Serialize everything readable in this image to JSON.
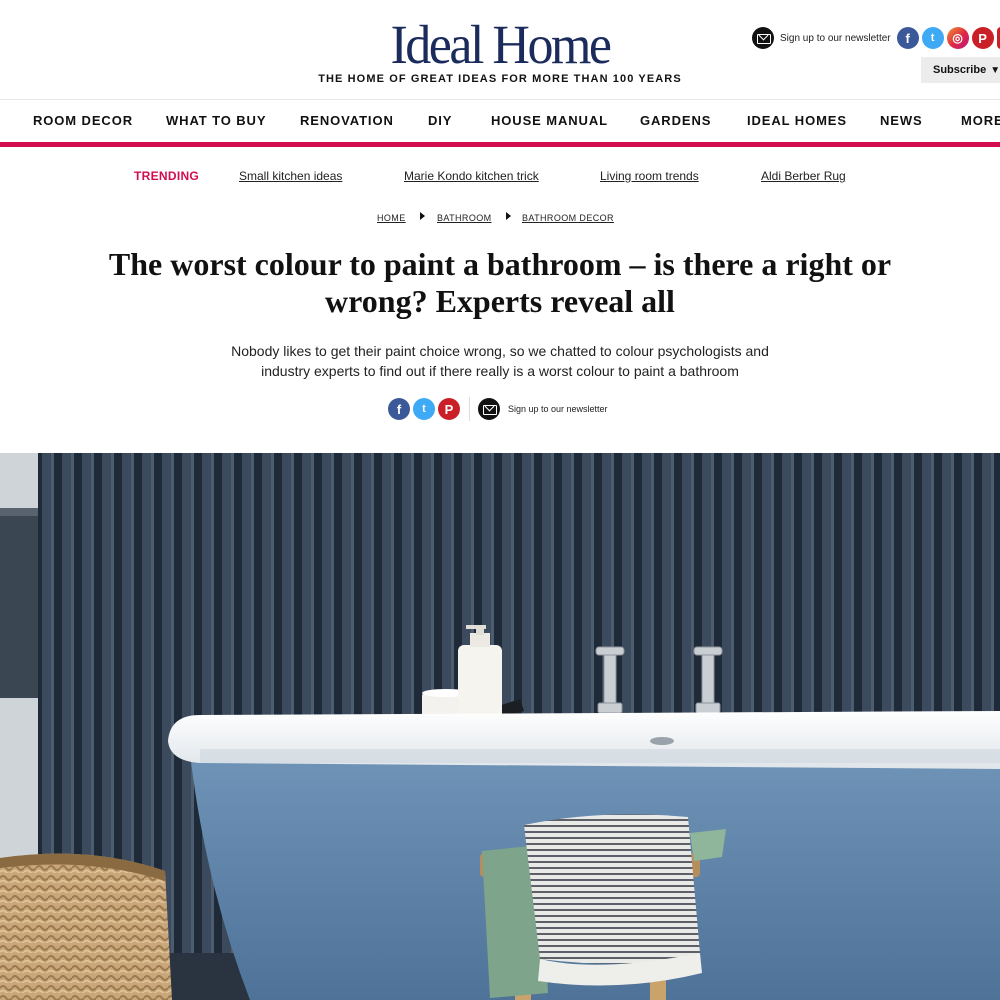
{
  "header": {
    "logo": "Ideal Home",
    "tagline": "THE HOME OF GREAT IDEAS FOR MORE THAN 100 YEARS",
    "newsletter_text": "Sign up to our newsletter",
    "subscribe_label": "Subscribe",
    "subscribe_arrow": "▼",
    "social": {
      "facebook": "f",
      "twitter": "t",
      "instagram": "◎",
      "pinterest": "P",
      "flipboard": "f"
    }
  },
  "nav": {
    "items": [
      "ROOM DECOR",
      "WHAT TO BUY",
      "RENOVATION",
      "DIY",
      "HOUSE MANUAL",
      "GARDENS",
      "IDEAL HOMES",
      "NEWS",
      "MORE"
    ]
  },
  "trending": {
    "label": "TRENDING",
    "links": [
      "Small kitchen ideas",
      "Marie Kondo kitchen trick",
      "Living room trends",
      "Aldi Berber Rug"
    ]
  },
  "breadcrumb": [
    "HOME",
    "BATHROOM",
    "BATHROOM DECOR"
  ],
  "article": {
    "title_line1": "The worst colour to paint a bathroom – is there a right or",
    "title_line2": "wrong? Experts reveal all",
    "standfirst_line1": "Nobody likes to get their paint choice wrong, so we chatted to colour psychologists and",
    "standfirst_line2": "industry experts to find out if there really is a worst colour to paint a bathroom",
    "share_newsletter": "Sign up to our newsletter"
  },
  "colors": {
    "brand_navy": "#1a2b5c",
    "accent_pink": "#d30d4d",
    "facebook": "#3b5998",
    "twitter": "#3ea9f5",
    "pinterest": "#cb1f27"
  }
}
